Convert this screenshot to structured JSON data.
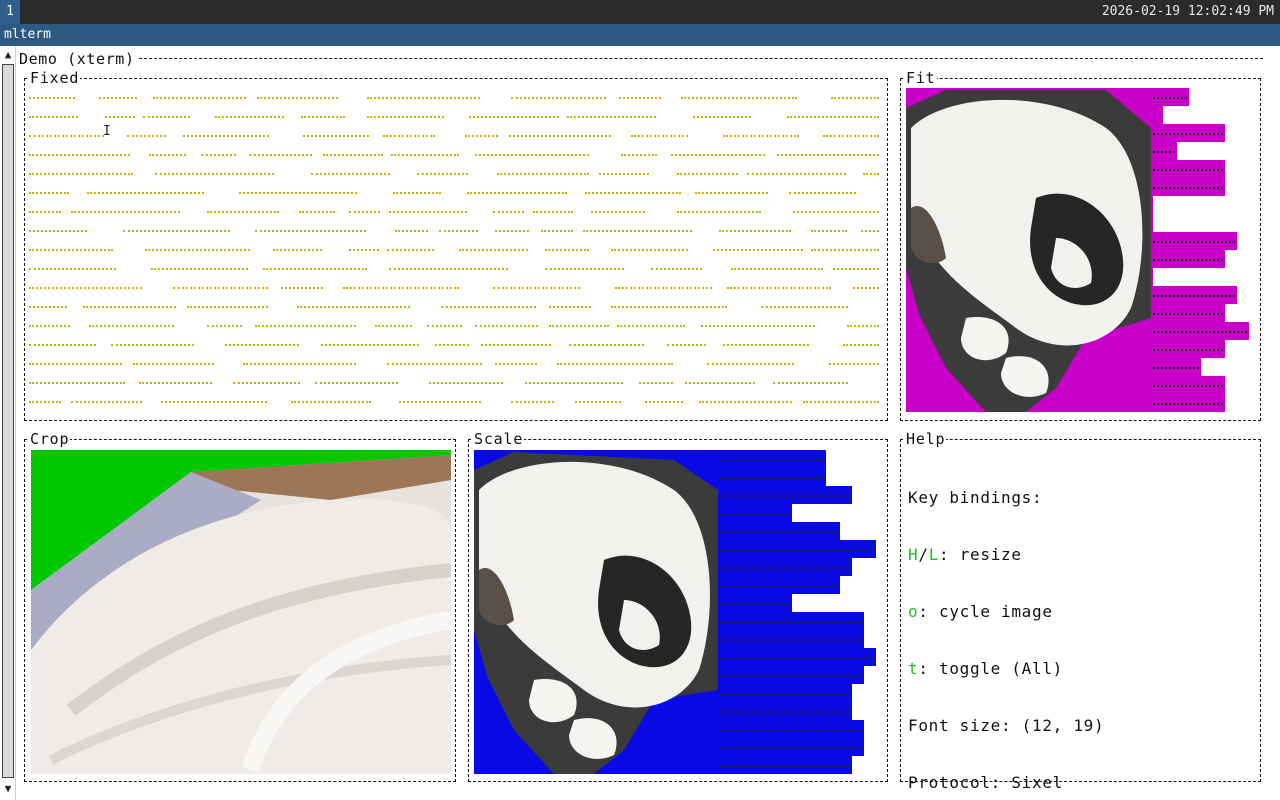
{
  "topbar": {
    "workspace": "1",
    "clock": "2026-02-19 12:02:49 PM"
  },
  "window": {
    "title": "mlterm"
  },
  "terminal": {
    "frame_title": "Demo (xterm)",
    "panes": {
      "fixed": {
        "title": "Fixed"
      },
      "fit": {
        "title": "Fit"
      },
      "crop": {
        "title": "Crop"
      },
      "scale": {
        "title": "Scale"
      },
      "help": {
        "title": "Help",
        "heading": "Key bindings:",
        "lines": [
          {
            "keys": "H",
            "sep": "/",
            "keys2": "L",
            "text": ": resize"
          },
          {
            "keys": "o",
            "text": ": cycle image"
          },
          {
            "keys": "t",
            "text": ": toggle (All)"
          }
        ],
        "font_size": "Font size: (12, 19)",
        "protocol": "Protocol: Sixel"
      }
    }
  },
  "colors": {
    "fit_bg": "#c800c8",
    "crop_bg": "#00c800",
    "scale_bg": "#0a0ae6",
    "key_green": "#1fbf1f",
    "dots_yellow": "#c9b400"
  },
  "icons": {
    "scroll_up": "▲",
    "scroll_down": "▼",
    "text_cursor": "I"
  }
}
